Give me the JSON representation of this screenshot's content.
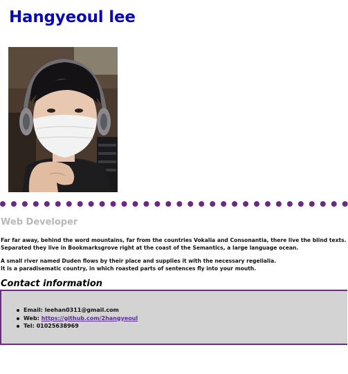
{
  "header": {
    "title": "Hangyeoul lee"
  },
  "profile": {
    "photo_icon": "profile-photo",
    "role": "Web Developer"
  },
  "about": {
    "paragraph1": [
      "Far far away, behind the word mountains, far from the countries Vokalia and Consonantia, there live the blind texts.",
      "Separated they live in Bookmarksgrove right at the coast of the Semantics, a large language ocean."
    ],
    "paragraph2": [
      "A small river named Duden flows by their place and supplies it with the necessary regelialia.",
      "It is a paradisematic country, in which roasted parts of sentences fly into your mouth."
    ]
  },
  "contact": {
    "heading": "Contact information",
    "items": [
      {
        "label": "Email:",
        "value": "leehan0311@gmail.com",
        "is_link": false
      },
      {
        "label": "Web:",
        "value": "https://github.com/2hangyeoul",
        "is_link": true
      },
      {
        "label": "Tel:",
        "value": "01025638969",
        "is_link": false
      }
    ]
  },
  "colors": {
    "title": "#0a0ab4",
    "divider": "#6a2a84",
    "subtitle": "#b8b8b8",
    "contact_bg": "#d3d3d3",
    "link": "#5a2a9a"
  }
}
